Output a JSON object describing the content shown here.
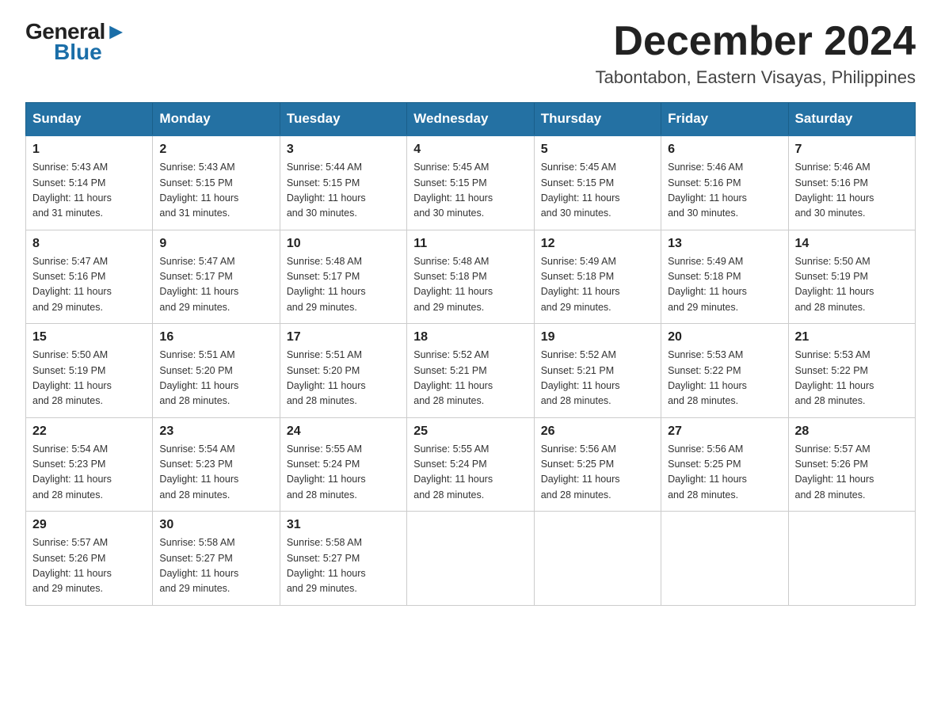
{
  "logo": {
    "general": "General",
    "blue": "Blue",
    "triangle": true
  },
  "title": "December 2024",
  "location": "Tabontabon, Eastern Visayas, Philippines",
  "weekdays": [
    "Sunday",
    "Monday",
    "Tuesday",
    "Wednesday",
    "Thursday",
    "Friday",
    "Saturday"
  ],
  "weeks": [
    [
      {
        "day": "1",
        "sunrise": "5:43 AM",
        "sunset": "5:14 PM",
        "daylight": "11 hours and 31 minutes."
      },
      {
        "day": "2",
        "sunrise": "5:43 AM",
        "sunset": "5:15 PM",
        "daylight": "11 hours and 31 minutes."
      },
      {
        "day": "3",
        "sunrise": "5:44 AM",
        "sunset": "5:15 PM",
        "daylight": "11 hours and 30 minutes."
      },
      {
        "day": "4",
        "sunrise": "5:45 AM",
        "sunset": "5:15 PM",
        "daylight": "11 hours and 30 minutes."
      },
      {
        "day": "5",
        "sunrise": "5:45 AM",
        "sunset": "5:15 PM",
        "daylight": "11 hours and 30 minutes."
      },
      {
        "day": "6",
        "sunrise": "5:46 AM",
        "sunset": "5:16 PM",
        "daylight": "11 hours and 30 minutes."
      },
      {
        "day": "7",
        "sunrise": "5:46 AM",
        "sunset": "5:16 PM",
        "daylight": "11 hours and 30 minutes."
      }
    ],
    [
      {
        "day": "8",
        "sunrise": "5:47 AM",
        "sunset": "5:16 PM",
        "daylight": "11 hours and 29 minutes."
      },
      {
        "day": "9",
        "sunrise": "5:47 AM",
        "sunset": "5:17 PM",
        "daylight": "11 hours and 29 minutes."
      },
      {
        "day": "10",
        "sunrise": "5:48 AM",
        "sunset": "5:17 PM",
        "daylight": "11 hours and 29 minutes."
      },
      {
        "day": "11",
        "sunrise": "5:48 AM",
        "sunset": "5:18 PM",
        "daylight": "11 hours and 29 minutes."
      },
      {
        "day": "12",
        "sunrise": "5:49 AM",
        "sunset": "5:18 PM",
        "daylight": "11 hours and 29 minutes."
      },
      {
        "day": "13",
        "sunrise": "5:49 AM",
        "sunset": "5:18 PM",
        "daylight": "11 hours and 29 minutes."
      },
      {
        "day": "14",
        "sunrise": "5:50 AM",
        "sunset": "5:19 PM",
        "daylight": "11 hours and 28 minutes."
      }
    ],
    [
      {
        "day": "15",
        "sunrise": "5:50 AM",
        "sunset": "5:19 PM",
        "daylight": "11 hours and 28 minutes."
      },
      {
        "day": "16",
        "sunrise": "5:51 AM",
        "sunset": "5:20 PM",
        "daylight": "11 hours and 28 minutes."
      },
      {
        "day": "17",
        "sunrise": "5:51 AM",
        "sunset": "5:20 PM",
        "daylight": "11 hours and 28 minutes."
      },
      {
        "day": "18",
        "sunrise": "5:52 AM",
        "sunset": "5:21 PM",
        "daylight": "11 hours and 28 minutes."
      },
      {
        "day": "19",
        "sunrise": "5:52 AM",
        "sunset": "5:21 PM",
        "daylight": "11 hours and 28 minutes."
      },
      {
        "day": "20",
        "sunrise": "5:53 AM",
        "sunset": "5:22 PM",
        "daylight": "11 hours and 28 minutes."
      },
      {
        "day": "21",
        "sunrise": "5:53 AM",
        "sunset": "5:22 PM",
        "daylight": "11 hours and 28 minutes."
      }
    ],
    [
      {
        "day": "22",
        "sunrise": "5:54 AM",
        "sunset": "5:23 PM",
        "daylight": "11 hours and 28 minutes."
      },
      {
        "day": "23",
        "sunrise": "5:54 AM",
        "sunset": "5:23 PM",
        "daylight": "11 hours and 28 minutes."
      },
      {
        "day": "24",
        "sunrise": "5:55 AM",
        "sunset": "5:24 PM",
        "daylight": "11 hours and 28 minutes."
      },
      {
        "day": "25",
        "sunrise": "5:55 AM",
        "sunset": "5:24 PM",
        "daylight": "11 hours and 28 minutes."
      },
      {
        "day": "26",
        "sunrise": "5:56 AM",
        "sunset": "5:25 PM",
        "daylight": "11 hours and 28 minutes."
      },
      {
        "day": "27",
        "sunrise": "5:56 AM",
        "sunset": "5:25 PM",
        "daylight": "11 hours and 28 minutes."
      },
      {
        "day": "28",
        "sunrise": "5:57 AM",
        "sunset": "5:26 PM",
        "daylight": "11 hours and 28 minutes."
      }
    ],
    [
      {
        "day": "29",
        "sunrise": "5:57 AM",
        "sunset": "5:26 PM",
        "daylight": "11 hours and 29 minutes."
      },
      {
        "day": "30",
        "sunrise": "5:58 AM",
        "sunset": "5:27 PM",
        "daylight": "11 hours and 29 minutes."
      },
      {
        "day": "31",
        "sunrise": "5:58 AM",
        "sunset": "5:27 PM",
        "daylight": "11 hours and 29 minutes."
      },
      null,
      null,
      null,
      null
    ]
  ],
  "cell_labels": {
    "sunrise": "Sunrise: ",
    "sunset": "Sunset: ",
    "daylight": "Daylight: "
  }
}
